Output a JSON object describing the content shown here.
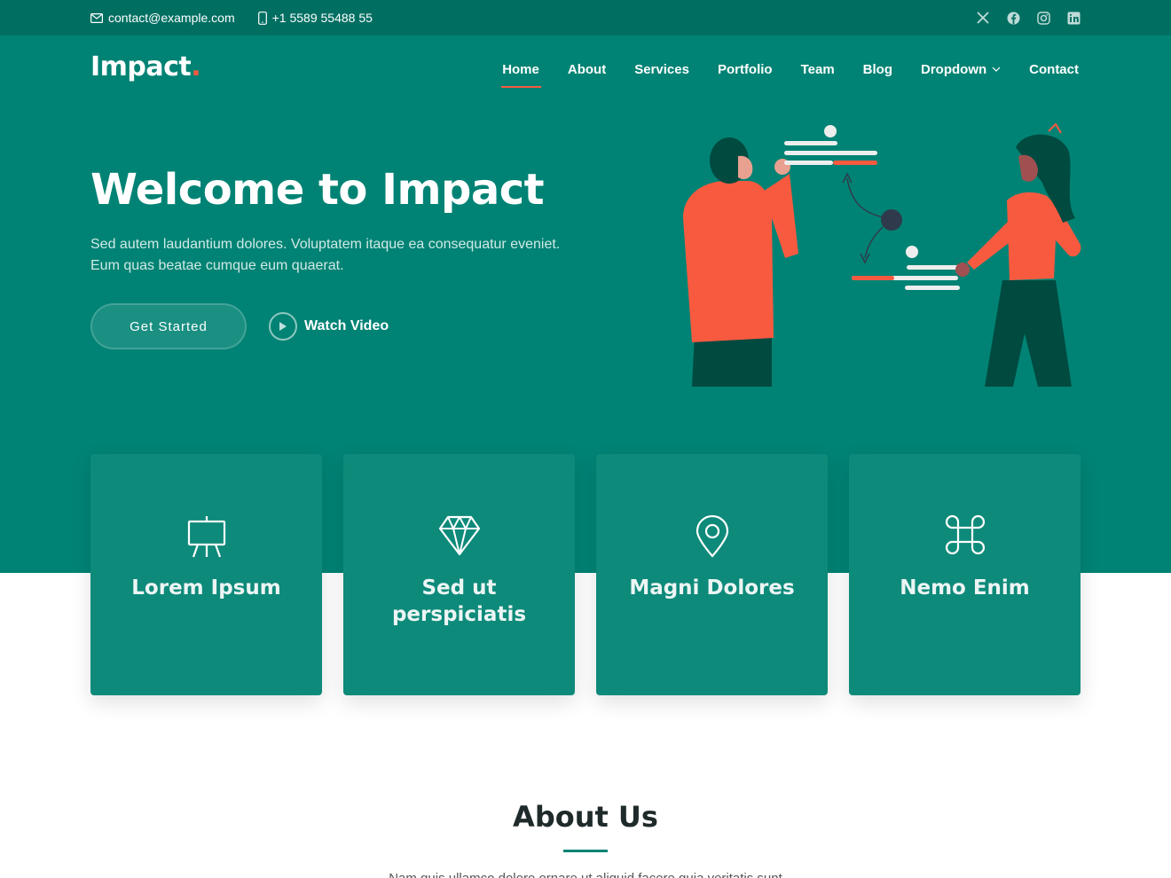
{
  "topbar": {
    "email": "contact@example.com",
    "phone": "+1 5589 55488 55",
    "social": [
      "x-icon",
      "facebook-icon",
      "instagram-icon",
      "linkedin-icon"
    ]
  },
  "header": {
    "logo": "Impact",
    "logo_dot": ".",
    "nav": {
      "home": "Home",
      "about": "About",
      "services": "Services",
      "portfolio": "Portfolio",
      "team": "Team",
      "blog": "Blog",
      "dropdown": "Dropdown",
      "contact": "Contact"
    }
  },
  "hero": {
    "title": "Welcome to Impact",
    "text": "Sed autem laudantium dolores. Voluptatem itaque ea consequatur eveniet. Eum quas beatae cumque eum quaerat.",
    "cta_start": "Get Started",
    "cta_video": "Watch Video"
  },
  "cards": [
    {
      "title": "Lorem Ipsum",
      "icon": "easel-icon"
    },
    {
      "title": "Sed ut perspiciatis",
      "icon": "gem-icon"
    },
    {
      "title": "Magni Dolores",
      "icon": "geo-pin-icon"
    },
    {
      "title": "Nemo Enim",
      "icon": "command-icon"
    }
  ],
  "about": {
    "title": "About Us",
    "text": "Nam quis ullamco dolore ornare ut aliquid facere quia veritatis sunt"
  },
  "colors": {
    "primary": "#008374",
    "topbar": "#006f62",
    "accent": "#f85a40",
    "card": "#0e8a7a"
  }
}
